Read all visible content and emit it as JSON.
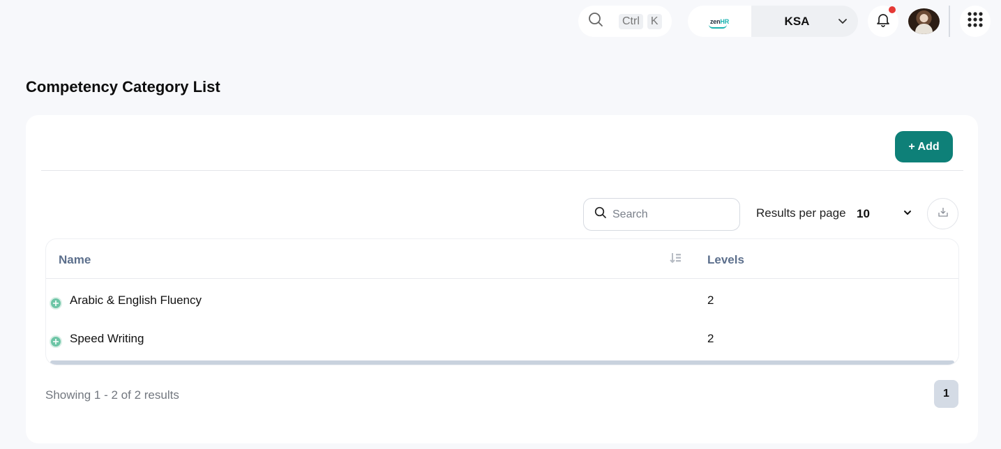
{
  "topbar": {
    "search_shortcut": [
      "Ctrl",
      "K"
    ],
    "search_icon": "search-icon",
    "company": {
      "logo_text_left": "zen",
      "logo_text_right": "HR",
      "name": "KSA"
    },
    "notification_icon": "bell-icon",
    "notification_badge_color": "#e53935",
    "apps_icon": "grid-icon"
  },
  "page": {
    "title": "Competency Category List"
  },
  "toolbar": {
    "add_label": "+ Add",
    "search_placeholder": "Search",
    "results_per_page_label": "Results per page",
    "results_per_page_value": "10",
    "download_icon": "download-icon"
  },
  "table": {
    "columns": [
      "Name",
      "Levels"
    ],
    "rows": [
      {
        "name": "Arabic & English Fluency",
        "levels": "2"
      },
      {
        "name": "Speed Writing",
        "levels": "2"
      }
    ]
  },
  "pagination": {
    "summary": "Showing 1 - 2 of 2 results",
    "current_page": "1"
  },
  "colors": {
    "primary": "#0e8078",
    "background": "#f7f8fb",
    "header_text": "#5c6f8c",
    "expand_icon": "#6dc5a6"
  }
}
